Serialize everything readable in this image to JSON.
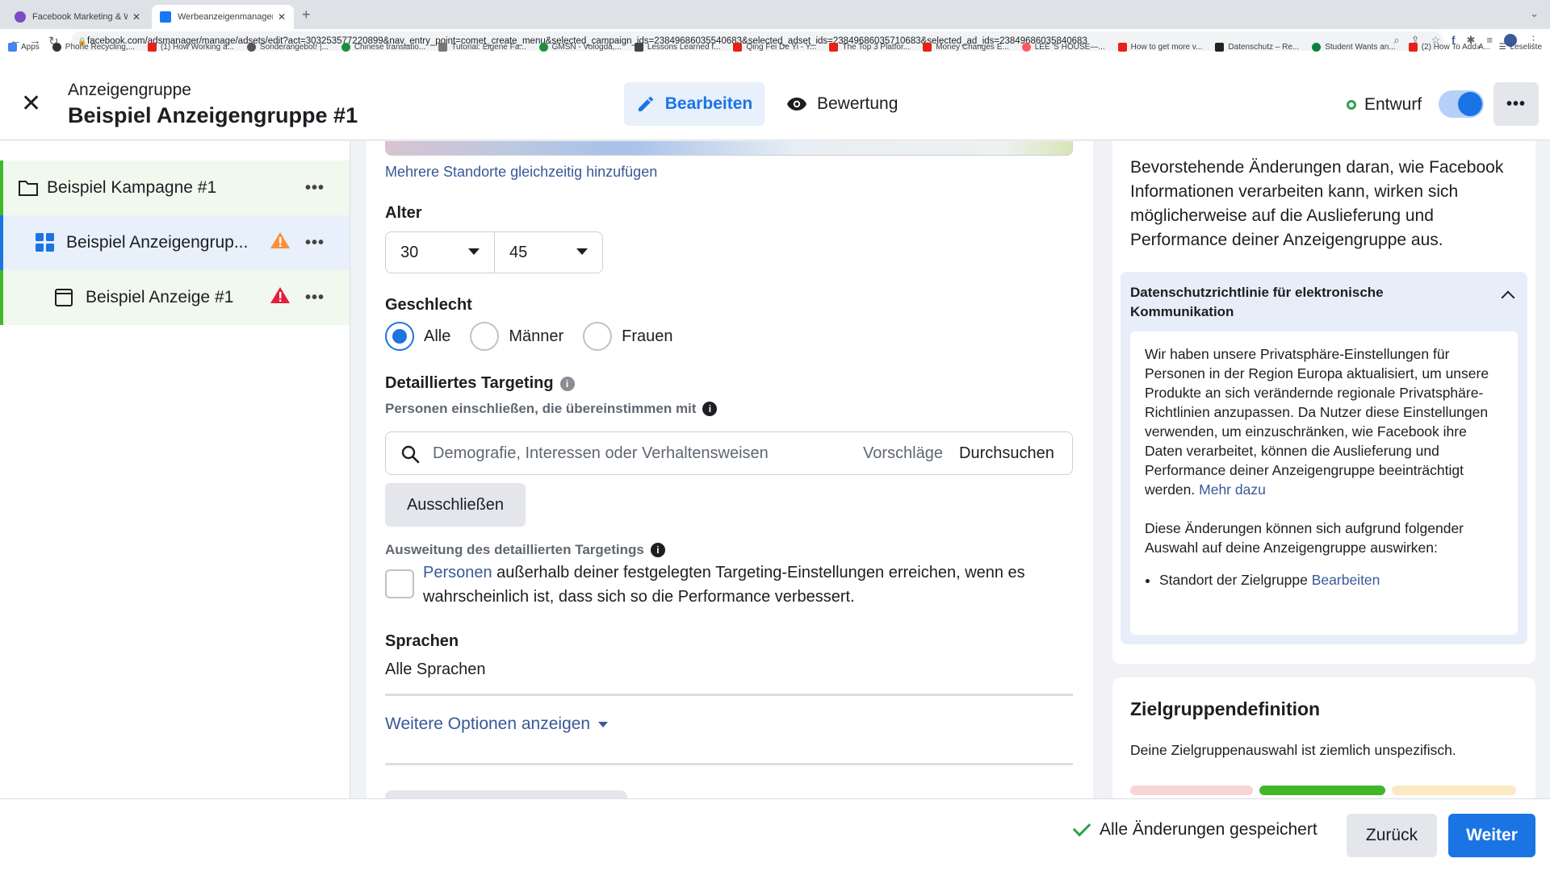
{
  "browser": {
    "tabs": [
      {
        "title": "Facebook Marketing & Werbea",
        "active": false
      },
      {
        "title": "Werbeanzeigenmanager - Wer",
        "active": true
      }
    ],
    "url": "facebook.com/adsmanager/manage/adsets/edit?act=303253577220899&nav_entry_point=comet_create_menu&selected_campaign_ids=23849686035540683&selected_adset_ids=23849686035710683&selected_ad_ids=23849686035840683",
    "bookmarks": [
      "Apps",
      "Phone Recycling,...",
      "(1) How Working a...",
      "Sonderangebot! |...",
      "Chinese translatio...",
      "Tutorial: Eigene Fa...",
      "GMSN - Vologda,...",
      "Lessons Learned f...",
      "Qing Fei De Yi - Y...",
      "The Top 3 Platfor...",
      "Money Changes E...",
      "LEE 'S HOUSE—...",
      "How to get more v...",
      "Datenschutz – Re...",
      "Student Wants an...",
      "(2) How To Add A..."
    ],
    "reading_list": "Leseliste"
  },
  "header": {
    "subtitle": "Anzeigengruppe",
    "title": "Beispiel Anzeigengruppe #1",
    "edit_label": "Bearbeiten",
    "review_label": "Bewertung",
    "status_label": "Entwurf",
    "toggle_on": true
  },
  "sidebar": {
    "items": [
      {
        "label": "Beispiel Kampagne #1",
        "type": "campaign"
      },
      {
        "label": "Beispiel Anzeigengrup...",
        "type": "adset",
        "warning": "orange"
      },
      {
        "label": "Beispiel Anzeige #1",
        "type": "ad",
        "warning": "red"
      }
    ]
  },
  "form": {
    "multi_location_link": "Mehrere Standorte gleichzeitig hinzufügen",
    "age": {
      "label": "Alter",
      "min": "30",
      "max": "45"
    },
    "gender": {
      "label": "Geschlecht",
      "options": [
        "Alle",
        "Männer",
        "Frauen"
      ],
      "selected": "Alle"
    },
    "targeting": {
      "label": "Detailliertes Targeting",
      "include_label": "Personen einschließen, die übereinstimmen mit",
      "search_placeholder": "Demografie, Interessen oder Verhaltensweisen",
      "suggestions": "Vorschläge",
      "browse": "Durchsuchen",
      "exclude_button": "Ausschließen"
    },
    "expansion": {
      "label": "Ausweitung des detaillierten Targetings",
      "link": "Personen",
      "text": " außerhalb deiner festgelegten Targeting-Einstellungen erreichen, wenn es wahrscheinlich ist, dass sich so die Performance verbessert.",
      "checked": false
    },
    "languages": {
      "label": "Sprachen",
      "value": "Alle Sprachen"
    },
    "more_options": "Weitere Optionen anzeigen"
  },
  "right": {
    "intro": "Bevorstehende Änderungen daran, wie Facebook Informationen verarbeiten kann, wirken sich möglicherweise auf die Auslieferung und Performance deiner Anzeigengruppe aus.",
    "privacy": {
      "title": "Datenschutzrichtlinie für elektronische Kommunikation",
      "body": "Wir haben unsere Privatsphäre-Einstellungen für Personen in der Region Europa aktualisiert, um unsere Produkte an sich verändernde regionale Privatsphäre-Richtlinien anzupassen. Da Nutzer diese Einstellungen verwenden, um einzuschränken, wie Facebook ihre Daten verarbeitet, können die Auslieferung und Performance deiner Anzeigengruppe beeinträchtigt werden.",
      "more_link": "Mehr dazu",
      "changes_text": "Diese Änderungen können sich aufgrund folgender Auswahl auf deine Anzeigengruppe auswirken:",
      "bullet_text": "Standort der Zielgruppe",
      "bullet_link": "Bearbeiten"
    },
    "audience": {
      "title": "Zielgruppendefinition",
      "text": "Deine Zielgruppenauswahl ist ziemlich unspezifisch.",
      "meter_colors": [
        "#f7d4d6",
        "#42b72a",
        "#fbe9c2"
      ]
    }
  },
  "footer": {
    "saved_label": "Alle Änderungen gespeichert",
    "back_label": "Zurück",
    "next_label": "Weiter"
  }
}
